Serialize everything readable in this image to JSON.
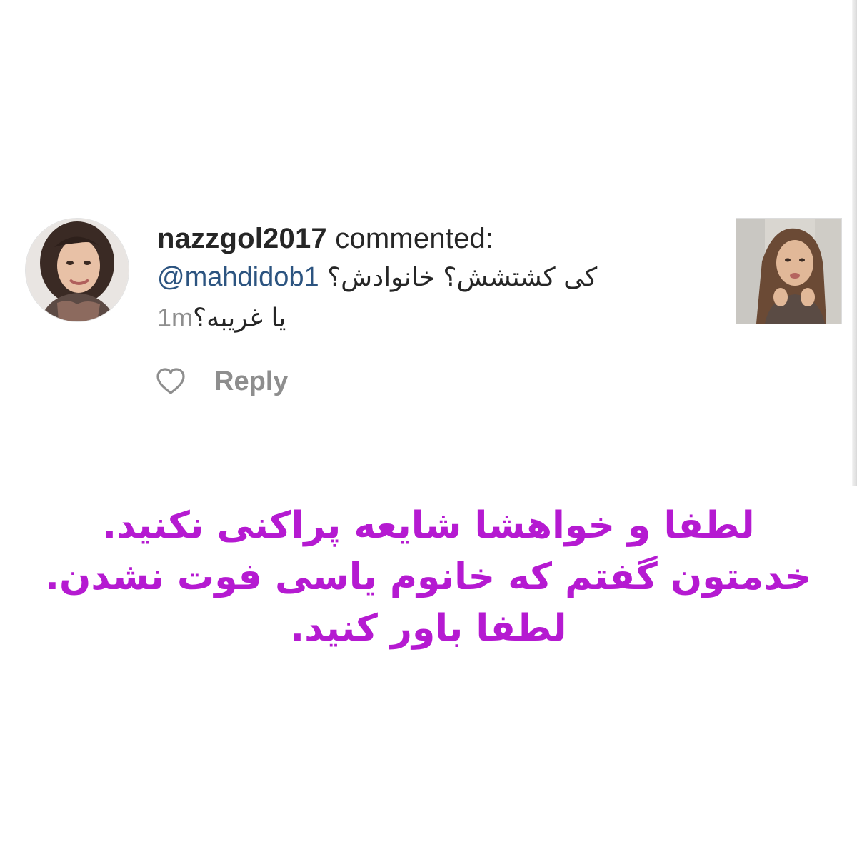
{
  "comment": {
    "username": "nazzgol2017",
    "verb": "commented:",
    "mention": "@mahdidob1",
    "line1_text": "کی کشتشش؟ خانوادش؟",
    "line2_text": "یا غریبه؟",
    "timestamp": "1m",
    "reply_label": "Reply",
    "icon": "heart-outline-icon"
  },
  "caption": {
    "color": "#b51ad1",
    "lines": [
      "لطفا و خواهشا شایعه پراکنی نکنید.",
      "خدمتون گفتم که خانوم یاسی فوت نشدن.",
      "لطفا باور کنید."
    ]
  }
}
